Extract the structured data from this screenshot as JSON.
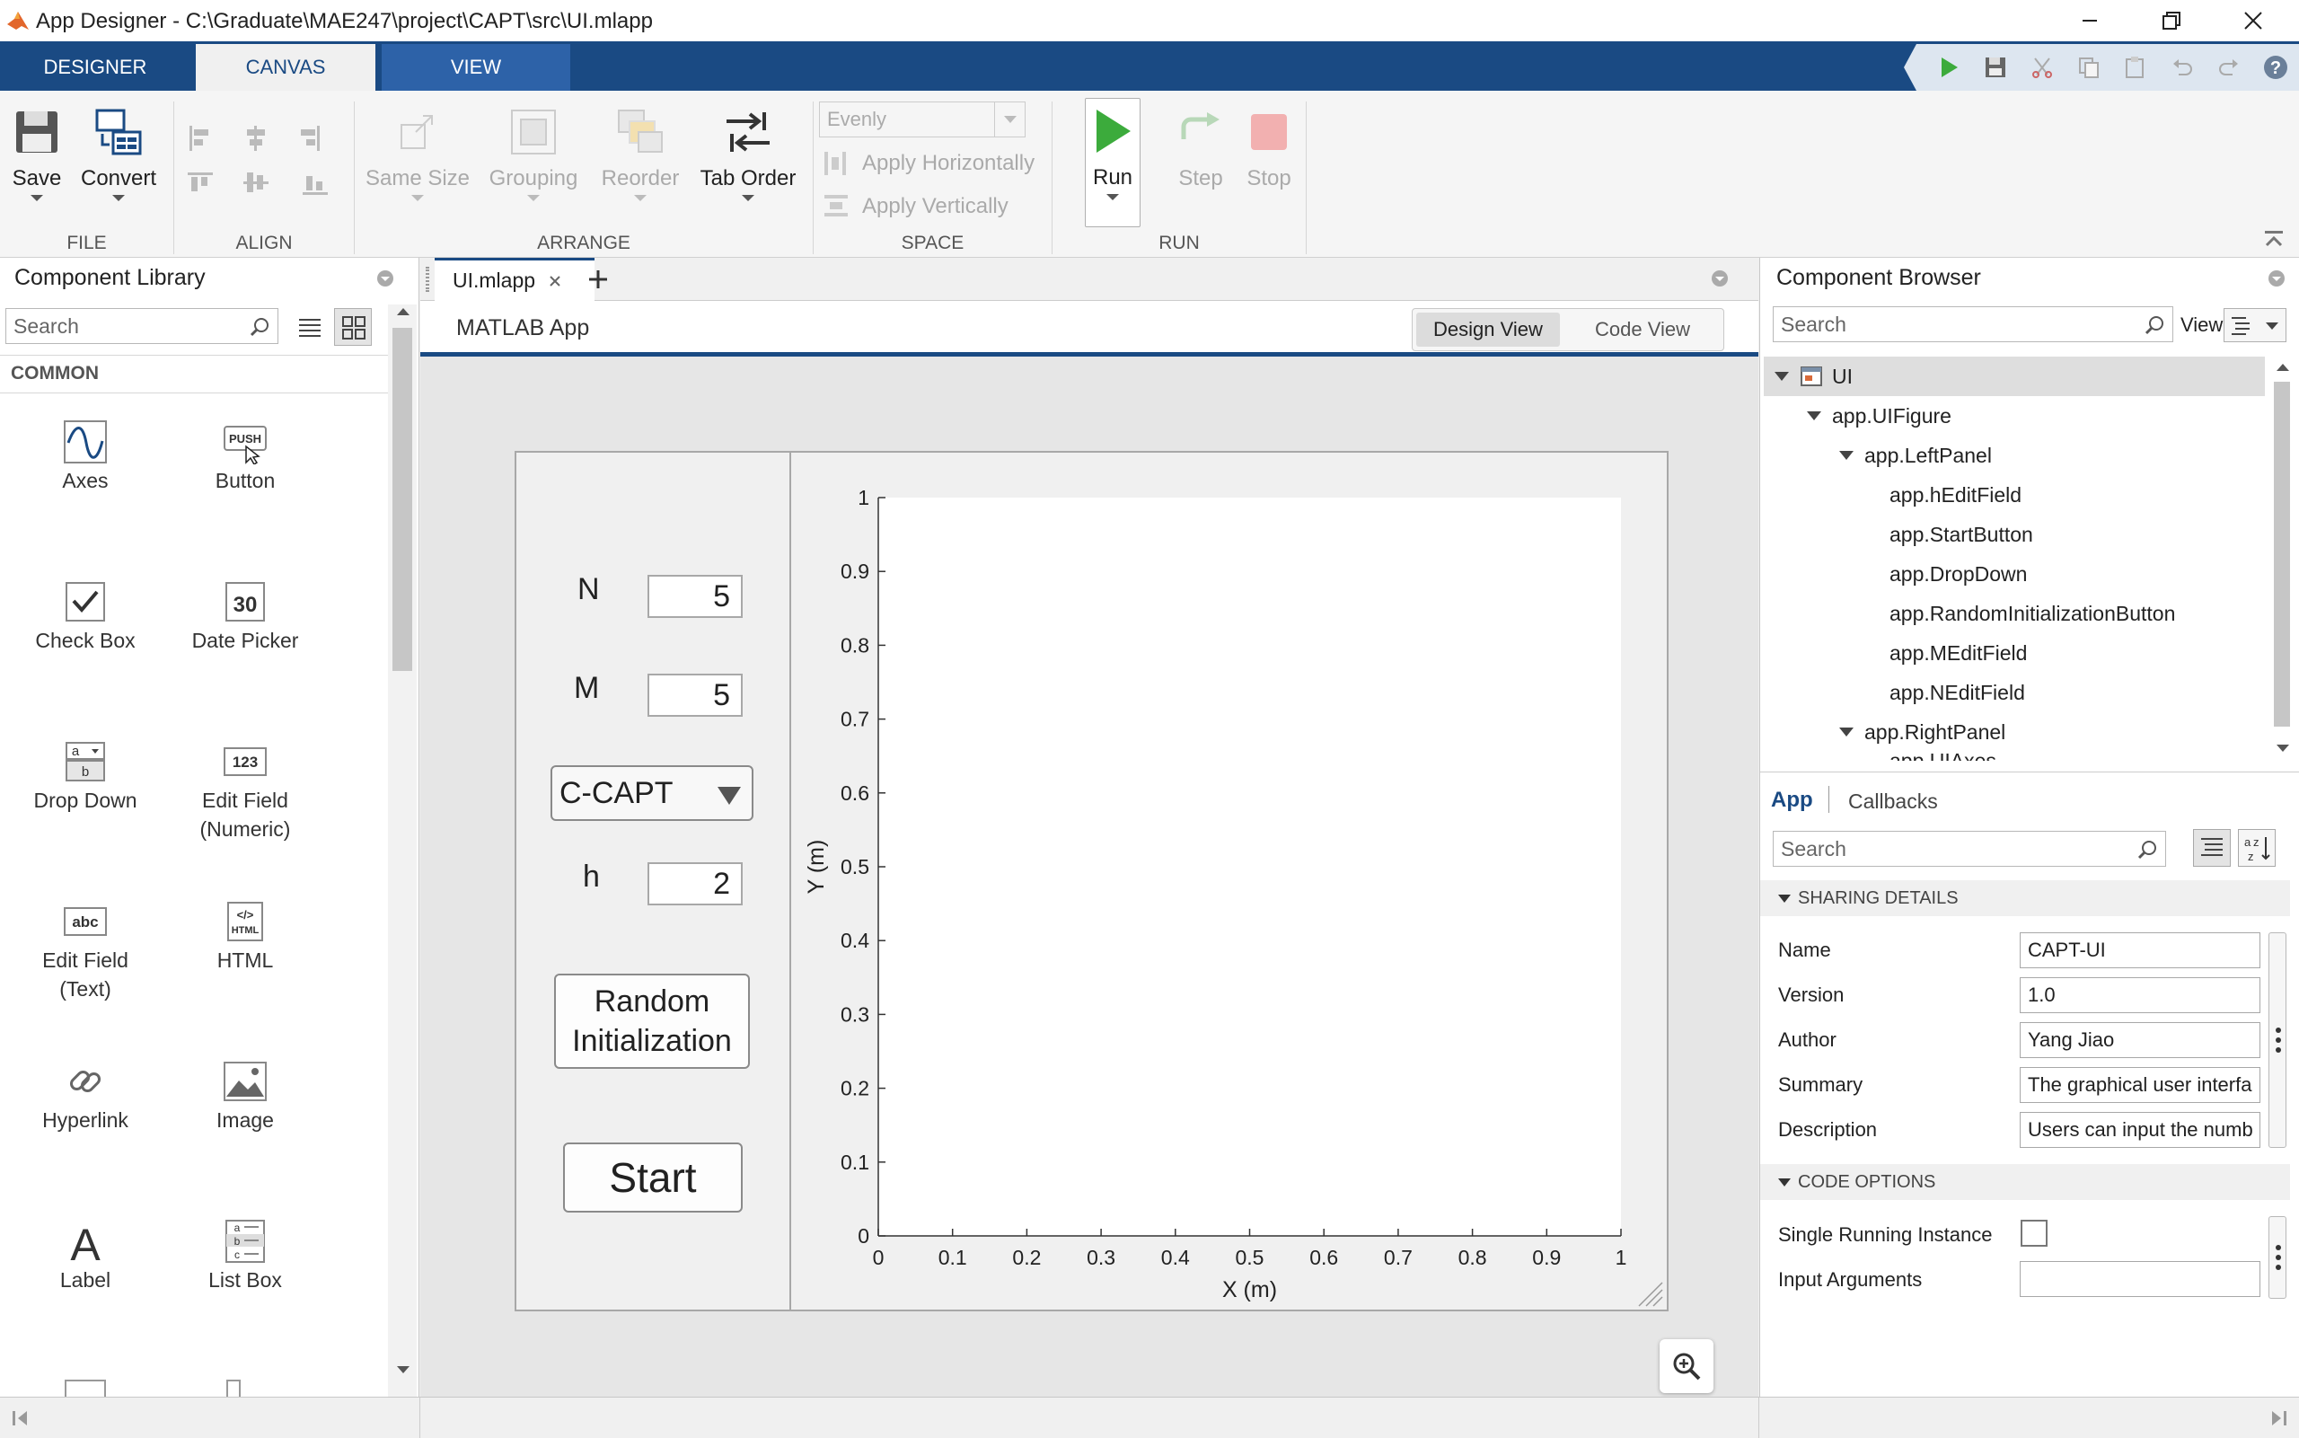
{
  "window": {
    "title": "App Designer - C:\\Graduate\\MAE247\\project\\CAPT\\src\\UI.mlapp"
  },
  "tabs": [
    {
      "label": "DESIGNER"
    },
    {
      "label": "CANVAS"
    },
    {
      "label": "VIEW"
    }
  ],
  "ribbon": {
    "save": "Save",
    "convert": "Convert",
    "same_size": "Same Size",
    "grouping": "Grouping",
    "reorder": "Reorder",
    "tab_order": "Tab Order",
    "evenly": "Evenly",
    "apply_h": "Apply Horizontally",
    "apply_v": "Apply Vertically",
    "run": "Run",
    "step": "Step",
    "stop": "Stop",
    "sections": {
      "file": "FILE",
      "align": "ALIGN",
      "arrange": "ARRANGE",
      "space": "SPACE",
      "run": "RUN"
    }
  },
  "library": {
    "title": "Component Library",
    "search_placeholder": "Search",
    "section": "COMMON",
    "items": [
      {
        "label": "Axes"
      },
      {
        "label": "Button"
      },
      {
        "label": "Check Box"
      },
      {
        "label": "Date Picker"
      },
      {
        "label": "Drop Down"
      },
      {
        "label": "Edit Field\n(Numeric)"
      },
      {
        "label": "Edit Field\n(Text)"
      },
      {
        "label": "HTML"
      },
      {
        "label": "Hyperlink"
      },
      {
        "label": "Image"
      },
      {
        "label": "Label"
      },
      {
        "label": "List Box"
      }
    ]
  },
  "document": {
    "tab": "UI.mlapp",
    "app_name": "MATLAB App",
    "design_view": "Design View",
    "code_view": "Code View"
  },
  "app_ui": {
    "n_label": "N",
    "n_value": "5",
    "m_label": "M",
    "m_value": "5",
    "dropdown_value": "C-CAPT",
    "h_label": "h",
    "h_value": "2",
    "random_init": "Random Initialization",
    "start": "Start"
  },
  "chart_data": {
    "type": "scatter",
    "xlabel": "X (m)",
    "ylabel": "Y (m)",
    "xlim": [
      0,
      1
    ],
    "ylim": [
      0,
      1
    ],
    "xticks": [
      "0",
      "0.1",
      "0.2",
      "0.3",
      "0.4",
      "0.5",
      "0.6",
      "0.7",
      "0.8",
      "0.9",
      "1"
    ],
    "yticks": [
      "0",
      "0.1",
      "0.2",
      "0.3",
      "0.4",
      "0.5",
      "0.6",
      "0.7",
      "0.8",
      "0.9",
      "1"
    ],
    "series": []
  },
  "browser": {
    "title": "Component Browser",
    "search_placeholder": "Search",
    "view_label": "View:",
    "tree": [
      {
        "label": "UI"
      },
      {
        "label": "app.UIFigure"
      },
      {
        "label": "app.LeftPanel"
      },
      {
        "label": "app.hEditField"
      },
      {
        "label": "app.StartButton"
      },
      {
        "label": "app.DropDown"
      },
      {
        "label": "app.RandomInitializationButton"
      },
      {
        "label": "app.MEditField"
      },
      {
        "label": "app.NEditField"
      },
      {
        "label": "app.RightPanel"
      },
      {
        "label": "app.UIAxes"
      }
    ],
    "app_tab": "App",
    "callbacks_tab": "Callbacks",
    "prop_search_placeholder": "Search",
    "sharing_details": "SHARING DETAILS",
    "code_options": "CODE OPTIONS",
    "props": [
      {
        "name": "Name",
        "value": "CAPT-UI"
      },
      {
        "name": "Version",
        "value": "1.0"
      },
      {
        "name": "Author",
        "value": "Yang Jiao"
      },
      {
        "name": "Summary",
        "value": "The graphical user interfa"
      },
      {
        "name": "Description",
        "value": "Users can input the numb"
      }
    ],
    "single_instance": "Single Running Instance",
    "input_args": "Input Arguments"
  },
  "colors": {
    "accent": "#1a4a83",
    "run_green": "#3cab3c",
    "stop_red": "#e07070"
  }
}
